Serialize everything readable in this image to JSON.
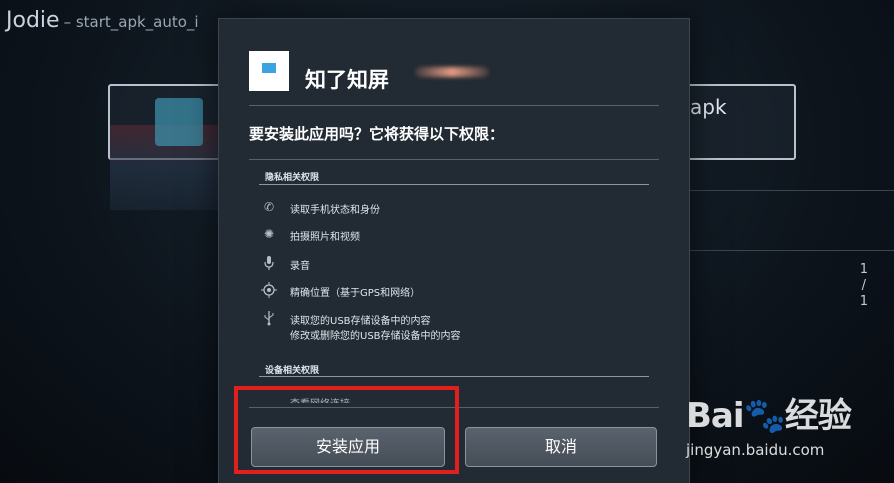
{
  "background": {
    "title": "Jodie",
    "subtitle": "– start_apk_auto_i",
    "card_label": "apk",
    "page_indicator": [
      "1",
      "/",
      "1"
    ]
  },
  "dialog": {
    "app_name": "知了知屏",
    "question": "要安装此应用吗？它将获得以下权限：",
    "sections": [
      {
        "title": "隐私相关权限",
        "permissions": [
          {
            "icon": "phone-icon",
            "text": "读取手机状态和身份"
          },
          {
            "icon": "camera-icon",
            "text": "拍摄照片和视频"
          },
          {
            "icon": "microphone-icon",
            "text": "录音"
          },
          {
            "icon": "location-icon",
            "text": "精确位置（基于GPS和网络）"
          },
          {
            "icon": "usb-icon",
            "text": "读取您的USB存储设备中的内容",
            "text2": "修改或删除您的USB存储设备中的内容"
          }
        ]
      },
      {
        "title": "设备相关权限",
        "permissions": [
          {
            "icon": "network-icon",
            "text": "查看网络连接"
          }
        ]
      }
    ],
    "install_label": "安装应用",
    "cancel_label": "取消"
  },
  "watermark": {
    "logo": "Bai",
    "logo_suffix": "经验",
    "url": "jingyan.baidu.com"
  },
  "colors": {
    "dialog_bg": "#222a33",
    "highlight": "#e11f1f",
    "accent_icon": "#3aa3e0"
  }
}
